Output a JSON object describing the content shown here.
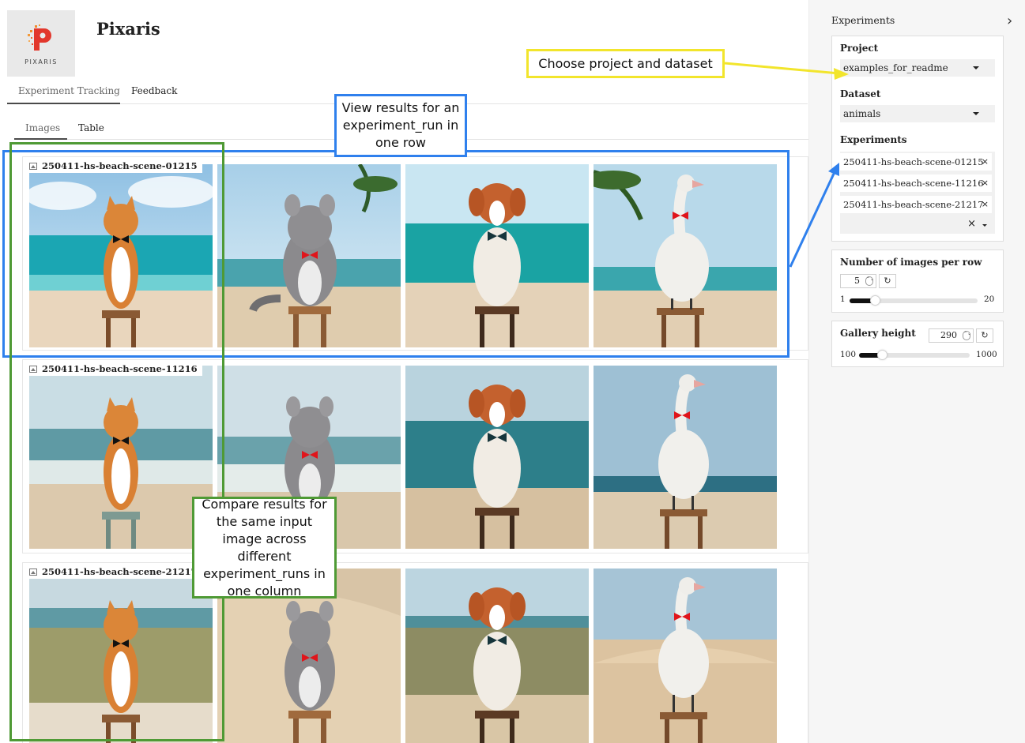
{
  "app": {
    "title": "Pixaris",
    "logo_text": "PIXARIS"
  },
  "top_tabs": [
    {
      "label": "Experiment Tracking",
      "active": true
    },
    {
      "label": "Feedback",
      "active": false
    }
  ],
  "sub_tabs": [
    {
      "label": "Images",
      "active": true
    },
    {
      "label": "Table",
      "active": false
    }
  ],
  "gallery": {
    "rows": [
      {
        "run": "250411-hs-beach-scene-01215",
        "scene": "turquoise beach"
      },
      {
        "run": "250411-hs-beach-scene-11216",
        "scene": "ocean waves"
      },
      {
        "run": "250411-hs-beach-scene-21217",
        "scene": "sand dunes"
      }
    ],
    "subjects": [
      "cat with black bow tie",
      "chinchilla with red bow tie",
      "dog with black bow tie",
      "goose with red bow tie"
    ]
  },
  "annotations": {
    "project_dataset": "Choose project and dataset",
    "row": "View results for an experiment_run in one row",
    "column": "Compare results for the same input image across different experiment_runs in one column",
    "colors": {
      "yellow": "#f2e52c",
      "blue": "#2f80ed",
      "green": "#4f9a35"
    }
  },
  "sidebar": {
    "title": "Experiments",
    "collapse_icon": "chevron-right-icon",
    "project": {
      "label": "Project",
      "value": "examples_for_readme"
    },
    "dataset": {
      "label": "Dataset",
      "value": "animals"
    },
    "experiments": {
      "label": "Experiments",
      "selected": [
        "250411-hs-beach-scene-01215",
        "250411-hs-beach-scene-11216",
        "250411-hs-beach-scene-21217"
      ]
    },
    "images_per_row": {
      "label": "Number of images per row",
      "value": "5",
      "min": "1",
      "max": "20",
      "fraction": 0.2
    },
    "gallery_height": {
      "label": "Gallery height",
      "value": "290",
      "min": "100",
      "max": "1000",
      "fraction": 0.21
    }
  }
}
